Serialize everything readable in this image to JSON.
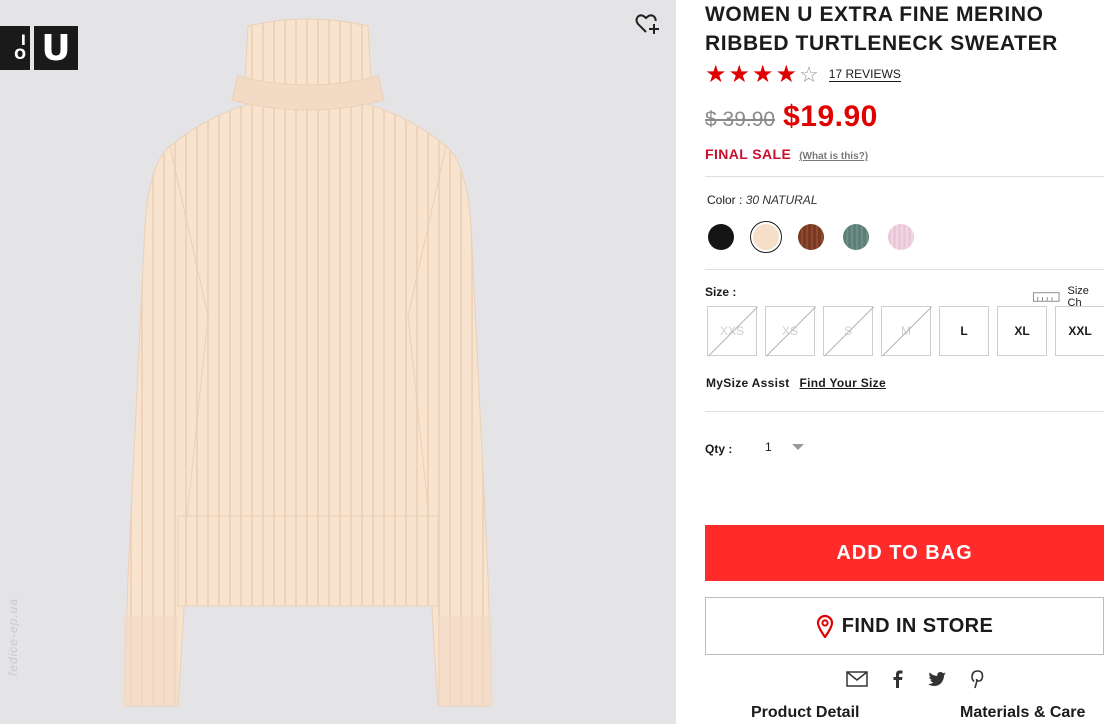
{
  "brand": {
    "logo_left": "I\nO",
    "logo_right": "U"
  },
  "watermark": "fedice-ep.ua",
  "product": {
    "title": "WOMEN U EXTRA FINE MERINO RIBBED TURTLENECK SWEATER",
    "rating": 4,
    "rating_max": 5,
    "reviews": "17 REVIEWS",
    "old_price": "$ 39.90",
    "new_price": "$19.90",
    "final_sale": "FINAL SALE",
    "what_is_this": "(What is this?)"
  },
  "color": {
    "label": "Color : ",
    "selected": "30 NATURAL",
    "swatches": [
      {
        "name": "black",
        "hex": "#151515"
      },
      {
        "name": "natural",
        "hex": "#f6dfc9",
        "selected": true
      },
      {
        "name": "brown",
        "hex": "#7a3a22"
      },
      {
        "name": "green",
        "hex": "#5e7f78"
      },
      {
        "name": "pink",
        "hex": "#e9c8d8"
      }
    ]
  },
  "size": {
    "label": "Size :",
    "chart_label": "Size Ch",
    "options": [
      {
        "label": "XXS",
        "available": false
      },
      {
        "label": "XS",
        "available": false
      },
      {
        "label": "S",
        "available": false
      },
      {
        "label": "M",
        "available": false
      },
      {
        "label": "L",
        "available": true
      },
      {
        "label": "XL",
        "available": true
      },
      {
        "label": "XXL",
        "available": true
      }
    ]
  },
  "mysize": {
    "label": "MySize Assist",
    "link": "Find Your Size"
  },
  "qty": {
    "label": "Qty :",
    "value": "1"
  },
  "buttons": {
    "add_to_bag": "ADD TO BAG",
    "find_in_store": "FIND IN STORE"
  },
  "share_icons": [
    "mail-icon",
    "facebook-icon",
    "twitter-icon",
    "pinterest-icon"
  ],
  "tabs": {
    "product_detail": "Product Detail",
    "materials_care": "Materials & Care"
  },
  "colors": {
    "accent_red": "#ff2a2a",
    "price_red": "#e00000",
    "image_bg": "#e4e4e7",
    "sweater": "#f8e3cf"
  }
}
